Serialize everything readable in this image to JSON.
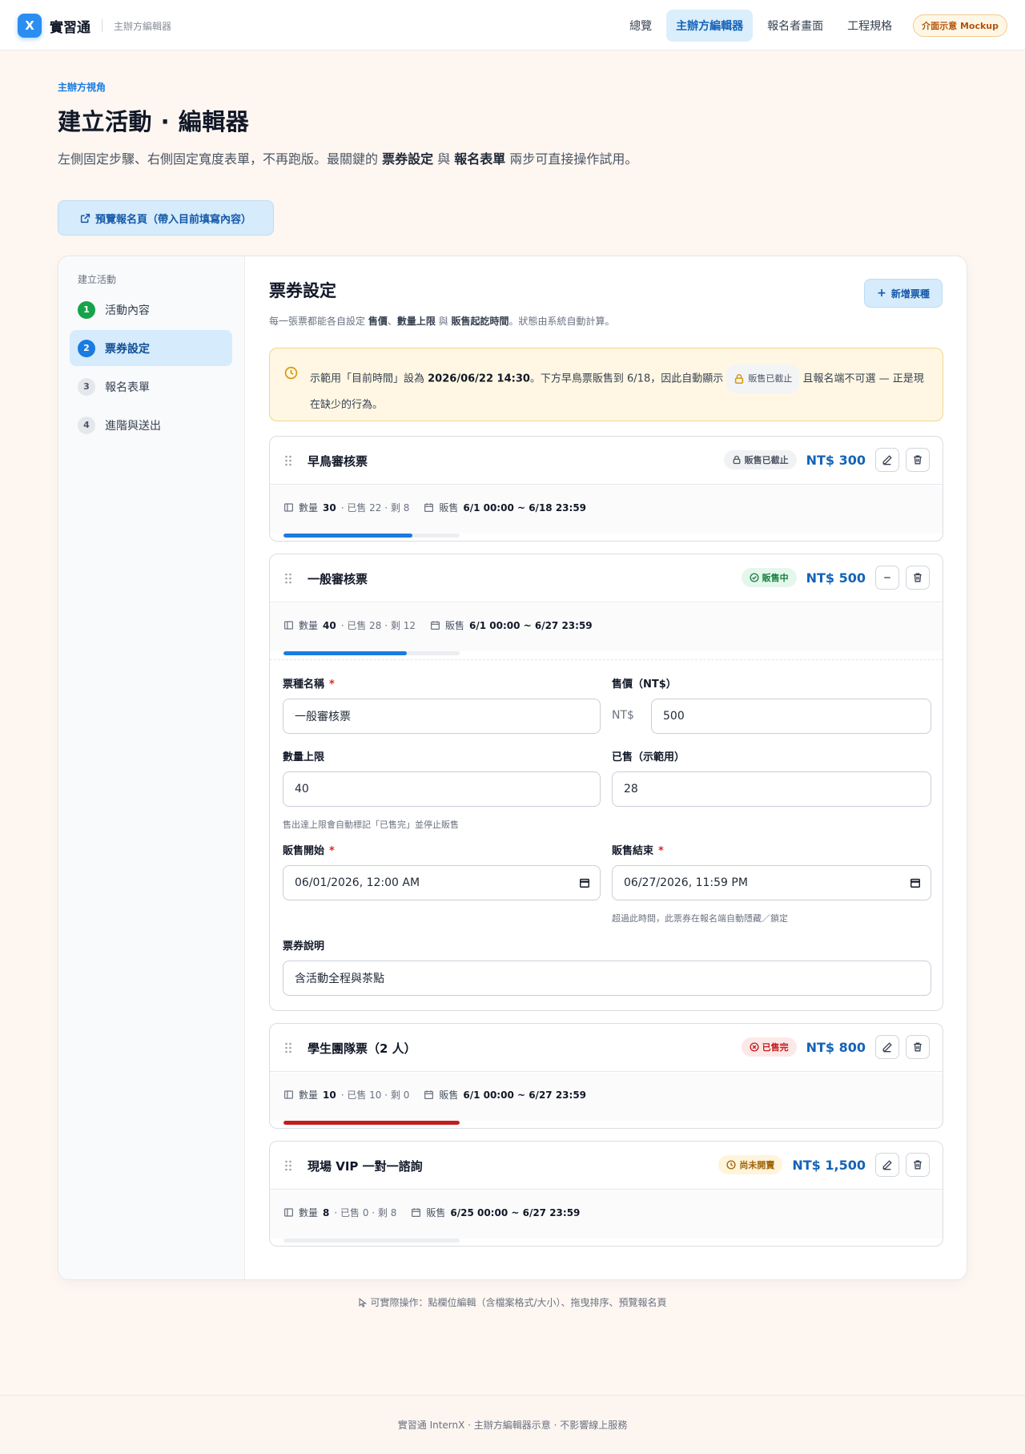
{
  "brand": {
    "logo": "X",
    "name": "實習通",
    "sub": "主辦方編輯器"
  },
  "nav": {
    "items": [
      "總覽",
      "主辦方編輯器",
      "報名者畫面",
      "工程規格"
    ],
    "badge": "介面示意 Mockup"
  },
  "hero": {
    "eyebrow": "主辦方視角",
    "title": "建立活動 · 編輯器",
    "desc_a": "左側固定步驟、右側固定寬度表單，不再跑版。最關鍵的 ",
    "desc_b": "票券設定",
    "desc_c": " 與 ",
    "desc_d": "報名表單",
    "desc_e": " 兩步可直接操作試用。",
    "preview": "預覽報名頁（帶入目前填寫內容）"
  },
  "sidebar": {
    "title": "建立活動",
    "steps": [
      {
        "num": "1",
        "label": "活動內容"
      },
      {
        "num": "2",
        "label": "票券設定"
      },
      {
        "num": "3",
        "label": "報名表單"
      },
      {
        "num": "4",
        "label": "進階與送出"
      }
    ]
  },
  "section": {
    "title": "票券設定",
    "add": "新增票種",
    "desc_a": "每一張票都能各自設定 ",
    "desc_b": "售價",
    "desc_c": "、",
    "desc_d": "數量上限",
    "desc_e": " 與 ",
    "desc_f": "販售起訖時間",
    "desc_g": "。狀態由系統自動計算。"
  },
  "notice": {
    "a": "示範用「目前時間」設為 ",
    "time": "2026/06/22 14:30",
    "b": "。下方早鳥票販售到 6/18，因此自動顯示",
    "pill": "販售已截止",
    "c": "且報名端不可選 — 正是現在缺少的行為。"
  },
  "tickets": [
    {
      "name": "早鳥審核票",
      "status": "販售已截止",
      "price": "NT$ 300",
      "qty_label": "數量",
      "qty": "30",
      "sold": "· 已售 22 · 剩 8",
      "sale_label": "販售",
      "sale": "6/1 00:00 ~ 6/18 23:59",
      "progress": 0.733
    },
    {
      "name": "一般審核票",
      "status": "販售中",
      "price": "NT$ 500",
      "qty_label": "數量",
      "qty": "40",
      "sold": "· 已售 28 · 剩 12",
      "sale_label": "販售",
      "sale": "6/1 00:00 ~ 6/27 23:59",
      "progress": 0.7
    },
    {
      "name": "學生團隊票（2 人）",
      "status": "已售完",
      "price": "NT$ 800",
      "qty_label": "數量",
      "qty": "10",
      "sold": "· 已售 10 · 剩 0",
      "sale_label": "販售",
      "sale": "6/1 00:00 ~ 6/27 23:59",
      "progress": 1.0
    },
    {
      "name": "現場 VIP 一對一諮詢",
      "status": "尚未開賣",
      "price": "NT$ 1,500",
      "qty_label": "數量",
      "qty": "8",
      "sold": "· 已售 0 · 剩 8",
      "sale_label": "販售",
      "sale": "6/25 00:00 ~ 6/27 23:59",
      "progress": 0.0
    }
  ],
  "form": {
    "name_label": "票種名稱",
    "name_value": "一般審核票",
    "price_label": "售價（NT$）",
    "price_prefix": "NT$",
    "price_value": "500",
    "qty_label": "數量上限",
    "qty_value": "40",
    "qty_hint": "售出達上限會自動標記「已售完」並停止販售",
    "sold_label": "已售（示範用）",
    "sold_value": "28",
    "start_label": "販售開始",
    "start_value": "06/01/2026, 12:00 AM",
    "end_label": "販售結束",
    "end_value": "06/27/2026, 11:59 PM",
    "end_hint": "超過此時間，此票券在報名端自動隱藏／鎖定",
    "desc_label": "票券說明",
    "desc_value": "含活動全程與茶點",
    "required_mark": "*"
  },
  "colors": {
    "live": "#1a7be0",
    "sold": "#c41c1c"
  },
  "foot_hint": "可實際操作：點欄位編輯（含檔案格式/大小）、拖曳排序、預覽報名頁",
  "footer": "實習通 InternX · 主辦方編輯器示意 · 不影響線上服務"
}
